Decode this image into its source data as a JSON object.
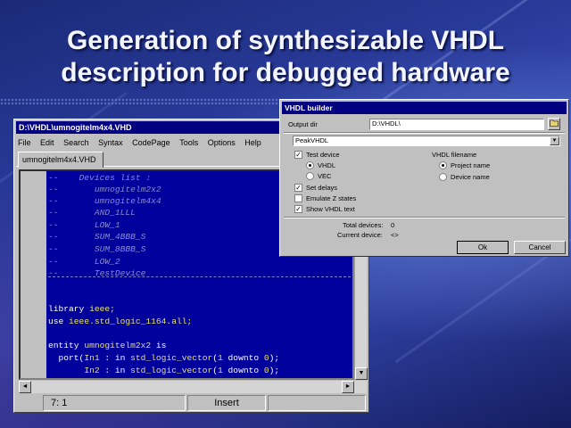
{
  "slide": {
    "title_line1": "Generation of synthesizable VHDL",
    "title_line2": "description for debugged hardware"
  },
  "editor": {
    "window_title": "D:\\VHDL\\umnogitelm4x4.VHD",
    "menu": [
      "File",
      "Edit",
      "Search",
      "Syntax",
      "CodePage",
      "Tools",
      "Options",
      "Help"
    ],
    "tab": "umnogitelm4x4.VHD",
    "code": {
      "comments": [
        "--    Devices list :",
        "--       umnogitelm2x2",
        "--       umnogitelm4x4",
        "--       AND_1LLL",
        "--       LOW_1",
        "--       SUM_4BBB_S",
        "--       SUM_8BBB_S",
        "--       LOW_2",
        "--       TestDevice"
      ],
      "library_kw": "library",
      "library_name": "ieee;",
      "use_kw": "use",
      "use_name": "ieee.std_logic_1164.all;",
      "entity_kw": "entity",
      "entity_name": "umnogitelm2x2",
      "is_kw": "is",
      "port_kw": "port(",
      "in1_name": "In1",
      "in2_name": "In2",
      "port_mode": " : in ",
      "type_name": "std_logic_vector",
      "range_open": "(",
      "range_hi": "1",
      "downto_kw": " downto ",
      "range_lo": "0",
      "range_close": ");"
    },
    "scroll_up": "▲",
    "scroll_down": "▼",
    "scroll_left": "◄",
    "scroll_right": "►",
    "status": {
      "position": "7:   1",
      "mode": "Insert"
    }
  },
  "dialog": {
    "title": "VHDL builder",
    "output_dir_label": "Output dir",
    "output_dir_value": "D:\\VHDL\\",
    "browse_icon": "folder-icon",
    "selected_entity": "PeakVHDL",
    "dropdown_arrow": "▼",
    "test_device_label": "Test device",
    "test_device_checked": true,
    "vhdl_option": "VHDL",
    "vec_option": "VEC",
    "vhdl_filename_label": "VHDL filename",
    "project_name_option": "Project name",
    "device_name_option": "Device name",
    "set_delays_label": "Set delays",
    "set_delays_checked": true,
    "emulate_z_label": "Emulate Z states",
    "emulate_z_checked": false,
    "show_vhdl_label": "Show VHDL text",
    "show_vhdl_checked": true,
    "total_devices_label": "Total devices:",
    "total_devices_value": "0",
    "current_device_label": "Current device:",
    "current_device_value": "<>",
    "ok_label": "Ok",
    "cancel_label": "Cancel",
    "check_mark": "✓"
  },
  "colors": {
    "code_bg": "#00009c",
    "titlebar": "#000080",
    "identifier": "#e8e070",
    "comment": "#8a8ad8"
  }
}
